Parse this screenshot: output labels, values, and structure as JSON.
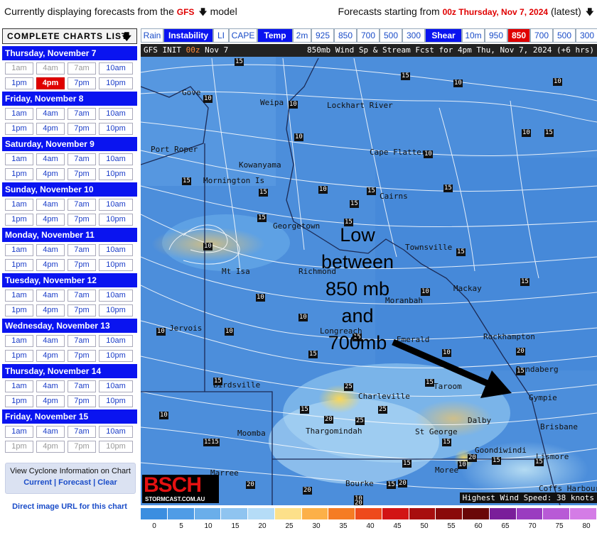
{
  "header": {
    "prefix": "Currently displaying forecasts from the",
    "model": "GFS",
    "suffix": "model",
    "start_prefix": "Forecasts starting from",
    "start_value": "00z Thursday, Nov 7, 2024",
    "start_suffix": "(latest)"
  },
  "sidebar": {
    "list_title": "COMPLETE CHARTS LIST",
    "days": [
      {
        "label": "Thursday, November 7",
        "slots": [
          {
            "t": "1am",
            "s": "dim"
          },
          {
            "t": "4am",
            "s": "dim"
          },
          {
            "t": "7am",
            "s": "dim"
          },
          {
            "t": "10am",
            "s": ""
          },
          {
            "t": "1pm",
            "s": ""
          },
          {
            "t": "4pm",
            "s": "sel"
          },
          {
            "t": "7pm",
            "s": ""
          },
          {
            "t": "10pm",
            "s": ""
          }
        ]
      },
      {
        "label": "Friday, November 8",
        "slots": [
          {
            "t": "1am",
            "s": ""
          },
          {
            "t": "4am",
            "s": ""
          },
          {
            "t": "7am",
            "s": ""
          },
          {
            "t": "10am",
            "s": ""
          },
          {
            "t": "1pm",
            "s": ""
          },
          {
            "t": "4pm",
            "s": ""
          },
          {
            "t": "7pm",
            "s": ""
          },
          {
            "t": "10pm",
            "s": ""
          }
        ]
      },
      {
        "label": "Saturday, November 9",
        "slots": [
          {
            "t": "1am",
            "s": ""
          },
          {
            "t": "4am",
            "s": ""
          },
          {
            "t": "7am",
            "s": ""
          },
          {
            "t": "10am",
            "s": ""
          },
          {
            "t": "1pm",
            "s": ""
          },
          {
            "t": "4pm",
            "s": ""
          },
          {
            "t": "7pm",
            "s": ""
          },
          {
            "t": "10pm",
            "s": ""
          }
        ]
      },
      {
        "label": "Sunday, November 10",
        "slots": [
          {
            "t": "1am",
            "s": ""
          },
          {
            "t": "4am",
            "s": ""
          },
          {
            "t": "7am",
            "s": ""
          },
          {
            "t": "10am",
            "s": ""
          },
          {
            "t": "1pm",
            "s": ""
          },
          {
            "t": "4pm",
            "s": ""
          },
          {
            "t": "7pm",
            "s": ""
          },
          {
            "t": "10pm",
            "s": ""
          }
        ]
      },
      {
        "label": "Monday, November 11",
        "slots": [
          {
            "t": "1am",
            "s": ""
          },
          {
            "t": "4am",
            "s": ""
          },
          {
            "t": "7am",
            "s": ""
          },
          {
            "t": "10am",
            "s": ""
          },
          {
            "t": "1pm",
            "s": ""
          },
          {
            "t": "4pm",
            "s": ""
          },
          {
            "t": "7pm",
            "s": ""
          },
          {
            "t": "10pm",
            "s": ""
          }
        ]
      },
      {
        "label": "Tuesday, November 12",
        "slots": [
          {
            "t": "1am",
            "s": ""
          },
          {
            "t": "4am",
            "s": ""
          },
          {
            "t": "7am",
            "s": ""
          },
          {
            "t": "10am",
            "s": ""
          },
          {
            "t": "1pm",
            "s": ""
          },
          {
            "t": "4pm",
            "s": ""
          },
          {
            "t": "7pm",
            "s": ""
          },
          {
            "t": "10pm",
            "s": ""
          }
        ]
      },
      {
        "label": "Wednesday, November 13",
        "slots": [
          {
            "t": "1am",
            "s": ""
          },
          {
            "t": "4am",
            "s": ""
          },
          {
            "t": "7am",
            "s": ""
          },
          {
            "t": "10am",
            "s": ""
          },
          {
            "t": "1pm",
            "s": ""
          },
          {
            "t": "4pm",
            "s": ""
          },
          {
            "t": "7pm",
            "s": ""
          },
          {
            "t": "10pm",
            "s": ""
          }
        ]
      },
      {
        "label": "Thursday, November 14",
        "slots": [
          {
            "t": "1am",
            "s": ""
          },
          {
            "t": "4am",
            "s": ""
          },
          {
            "t": "7am",
            "s": ""
          },
          {
            "t": "10am",
            "s": ""
          },
          {
            "t": "1pm",
            "s": ""
          },
          {
            "t": "4pm",
            "s": ""
          },
          {
            "t": "7pm",
            "s": ""
          },
          {
            "t": "10pm",
            "s": ""
          }
        ]
      },
      {
        "label": "Friday, November 15",
        "slots": [
          {
            "t": "1am",
            "s": ""
          },
          {
            "t": "4am",
            "s": ""
          },
          {
            "t": "7am",
            "s": ""
          },
          {
            "t": "10am",
            "s": ""
          },
          {
            "t": "1pm",
            "s": "dim"
          },
          {
            "t": "4pm",
            "s": "dim"
          },
          {
            "t": "7pm",
            "s": "dim"
          },
          {
            "t": "10pm",
            "s": "dim"
          }
        ]
      }
    ],
    "cyclone_title": "View Cyclone Information on Chart",
    "cyclone_current": "Current",
    "cyclone_forecast": "Forecast",
    "cyclone_clear": "Clear",
    "direct_url": "Direct image URL for this chart"
  },
  "toolbar": [
    {
      "label": "Rain",
      "type": ""
    },
    {
      "label": "Instability",
      "type": "group"
    },
    {
      "label": "LI",
      "type": ""
    },
    {
      "label": "CAPE",
      "type": ""
    },
    {
      "label": "Temp",
      "type": "group"
    },
    {
      "label": "2m",
      "type": ""
    },
    {
      "label": "925",
      "type": ""
    },
    {
      "label": "850",
      "type": ""
    },
    {
      "label": "700",
      "type": ""
    },
    {
      "label": "500",
      "type": ""
    },
    {
      "label": "300",
      "type": ""
    },
    {
      "label": "Shear",
      "type": "group"
    },
    {
      "label": "10m",
      "type": ""
    },
    {
      "label": "950",
      "type": ""
    },
    {
      "label": "850",
      "type": "active"
    },
    {
      "label": "700",
      "type": ""
    },
    {
      "label": "500",
      "type": ""
    },
    {
      "label": "300",
      "type": ""
    }
  ],
  "map": {
    "init_prefix": "GFS INIT",
    "init_hour": "00z",
    "init_date": "Nov 7",
    "title": "850mb Wind Sp & Stream Fcst for 4pm Thu, Nov 7, 2024 (+6 hrs)",
    "places": [
      "Gove",
      "Weipa",
      "Lockhart River",
      "Port Roper",
      "Cape Flattery",
      "Kowanyama",
      "Mornington Is",
      "Cairns",
      "Georgetown",
      "Townsville",
      "Mt Isa",
      "Richmond",
      "Mackay",
      "Moranbah",
      "Jervois",
      "Longreach",
      "Emerald",
      "Rockhampton",
      "Bundaberg",
      "Birdsville",
      "Charleville",
      "Taroom",
      "Gympie",
      "Dalby",
      "Moomba",
      "Thargomindah",
      "St George",
      "Brisbane",
      "Goondiwindi",
      "Marree",
      "Bourke",
      "Moree",
      "Lismore",
      "Coffs Harbour"
    ],
    "wind_labels": [
      "15",
      "15",
      "10",
      "10",
      "10",
      "10",
      "10",
      "15",
      "10",
      "10",
      "15",
      "15",
      "15",
      "10",
      "15",
      "15",
      "15",
      "15",
      "15",
      "10",
      "10",
      "15",
      "10",
      "10",
      "10",
      "10",
      "15",
      "10",
      "15",
      "15",
      "25",
      "15",
      "15",
      "20",
      "15",
      "10",
      "25",
      "20",
      "25",
      "20",
      "15",
      "15",
      "15",
      "15",
      "20",
      "10",
      "15",
      "20",
      "20",
      "20",
      "15",
      "10",
      "15"
    ],
    "annotation": [
      "Low",
      "between",
      "850 mb",
      "and",
      "700mb"
    ],
    "logo": "BSCH",
    "logo_sub": "STORMCAST.COM.AU",
    "highest": "Highest Wind Speed: 38 knots"
  },
  "legend": {
    "colors": [
      "#3b8ee0",
      "#4f9ce6",
      "#6aaeea",
      "#8fc4f0",
      "#b5dcf7",
      "#fde08a",
      "#fcb048",
      "#f57c24",
      "#ee4a1c",
      "#d21414",
      "#a80e0e",
      "#8a0a0a",
      "#6a0808",
      "#7a1e9a",
      "#9a3cc0",
      "#b85ad6",
      "#d47ce6"
    ],
    "labels": [
      "0",
      "5",
      "10",
      "15",
      "20",
      "25",
      "30",
      "35",
      "40",
      "45",
      "50",
      "55",
      "60",
      "65",
      "70",
      "75",
      "80"
    ]
  }
}
